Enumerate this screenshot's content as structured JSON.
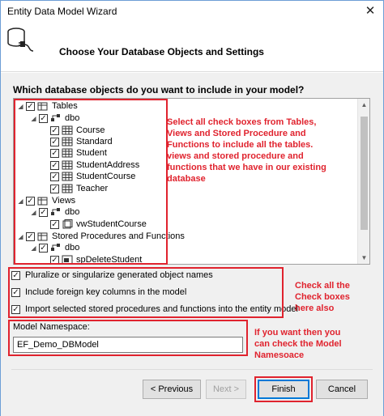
{
  "window": {
    "title": "Entity Data Model Wizard"
  },
  "header": {
    "title": "Choose Your Database Objects and Settings"
  },
  "question": "Which database objects do you want to include in your model?",
  "tree": {
    "tables": {
      "label": "Tables",
      "schema": "dbo",
      "items": [
        "Course",
        "Standard",
        "Student",
        "StudentAddress",
        "StudentCourse",
        "Teacher"
      ]
    },
    "views": {
      "label": "Views",
      "schema": "dbo",
      "items": [
        "vwStudentCourse"
      ]
    },
    "procs": {
      "label": "Stored Procedures and Functions",
      "schema": "dbo",
      "items": [
        "spDeleteStudent"
      ]
    }
  },
  "annotations": {
    "tree_note": [
      "Select all check boxes from Tables,",
      "Views and Stored Procedure and",
      "Functions to include all the tables.",
      "views and stored procedure and",
      "functions that we have in our existing",
      "database"
    ],
    "options_note": [
      "Check all the",
      "Check boxes",
      "here also"
    ],
    "namespace_note": [
      "If you want then you",
      "can check the Model",
      "Namesoace"
    ]
  },
  "options": [
    {
      "label": "Pluralize or singularize generated object names",
      "checked": true
    },
    {
      "label": "Include foreign key columns in the model",
      "checked": true
    },
    {
      "label": "Import selected stored procedures and functions into the entity model",
      "checked": true
    }
  ],
  "namespace": {
    "label": "Model Namespace:",
    "value": "EF_Demo_DBModel"
  },
  "buttons": {
    "previous": "< Previous",
    "next": "Next >",
    "finish": "Finish",
    "cancel": "Cancel"
  },
  "colors": {
    "annotation": "#e0232e",
    "focus": "#0078d7"
  }
}
